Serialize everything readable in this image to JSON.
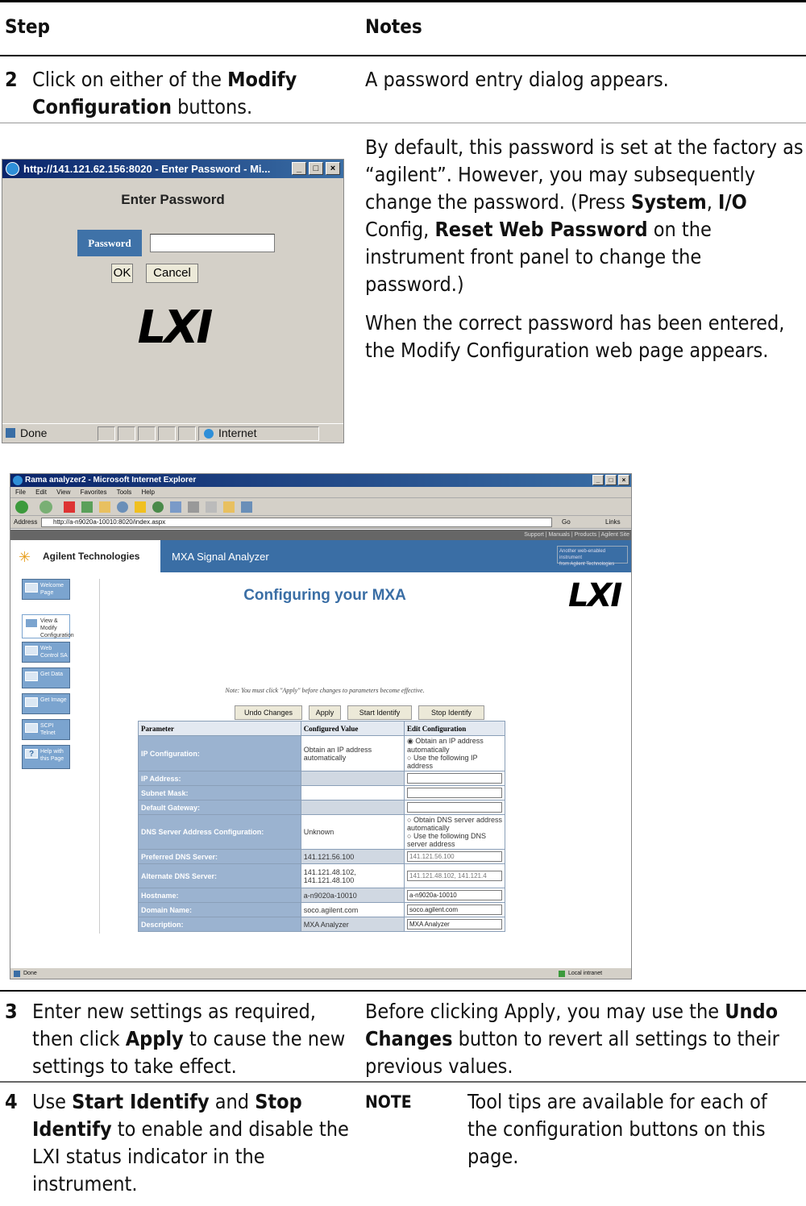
{
  "header": {
    "step": "Step",
    "notes": "Notes"
  },
  "step2": {
    "num": "2",
    "text1": "Click on either of the ",
    "bold1": "Modify",
    "bold2": "Configuration",
    "text2": " buttons.",
    "note": "A password entry dialog appears."
  },
  "notes_block": {
    "p1_a": "By default, this password is set at the factory as",
    "p1_b": "“agilent”. However, you may subsequently",
    "p1_c1": "change the password. (Press ",
    "p1_c_b1": "System",
    "p1_c2": ", ",
    "p1_c_b2": "I/O",
    "p1_d1": "Config, ",
    "p1_d_b": "Reset Web Password",
    "p1_d2": " on the",
    "p1_e": "instrument front panel to change the password.)",
    "p2_a": "When the correct password has been entered,",
    "p2_b": "the Modify Configuration web page appears."
  },
  "password_dialog": {
    "title": "http://141.121.62.156:8020 - Enter Password - Mi...",
    "heading": "Enter Password",
    "label": "Password",
    "ok": "OK",
    "cancel": "Cancel",
    "logo": "LXI",
    "status": "Done",
    "zone": "Internet"
  },
  "browser": {
    "title": "Rama analyzer2 - Microsoft Internet Explorer",
    "menu": [
      "File",
      "Edit",
      "View",
      "Favorites",
      "Tools",
      "Help"
    ],
    "address_label": "Address",
    "address": "http://a-n9020a-10010:8020/index.aspx",
    "go": "Go",
    "links": "Links",
    "top_links": "Support | Manuals | Products | Agilent Site",
    "brand": "Agilent Technologies",
    "product": "MXA Signal Analyzer",
    "banner_note_1": "Another web-enabled instrument",
    "banner_note_2": "from Agilent Technologies",
    "page_title": "Configuring your MXA",
    "logo": "LXI",
    "note": "Note: You must click \"Apply\" before changes to parameters become effective.",
    "nav": [
      {
        "label": "Welcome Page"
      },
      {
        "label": "View & Modify Configuration"
      },
      {
        "label": "Web Control SA"
      },
      {
        "label": "Get Data"
      },
      {
        "label": "Get Image"
      },
      {
        "label": "SCPI Telnet"
      },
      {
        "label": "Help with this Page"
      }
    ],
    "buttons": {
      "undo": "Undo Changes",
      "apply": "Apply",
      "start": "Start Identify",
      "stop": "Stop Identify"
    },
    "table_header": {
      "param": "Parameter",
      "configured": "Configured Value",
      "edit": "Edit Configuration"
    },
    "rows": [
      {
        "param": "IP Configuration:",
        "value": "Obtain an IP address automatically",
        "edit1": "Obtain an IP address automatically",
        "edit2": "Use the following IP address"
      },
      {
        "param": "IP Address:",
        "value": "",
        "edit": ""
      },
      {
        "param": "Subnet Mask:",
        "value": "",
        "edit": ""
      },
      {
        "param": "Default Gateway:",
        "value": "",
        "edit": ""
      },
      {
        "param": "DNS Server Address Configuration:",
        "value": "Unknown",
        "edit1": "Obtain DNS server address automatically",
        "edit2": "Use the following DNS server address"
      },
      {
        "param": "Preferred DNS Server:",
        "value": "141.121.56.100",
        "edit": "141.121.56.100"
      },
      {
        "param": "Alternate DNS Server:",
        "value": "141.121.48.102, 141.121.48.100",
        "edit": "141.121.48.102, 141.121.4"
      },
      {
        "param": "Hostname:",
        "value": "a-n9020a-10010",
        "edit": "a-n9020a-10010"
      },
      {
        "param": "Domain Name:",
        "value": "soco.agilent.com",
        "edit": "soco.agilent.com"
      },
      {
        "param": "Description:",
        "value": "MXA Analyzer",
        "edit": "MXA Analyzer"
      }
    ],
    "status": "Done",
    "zone": "Local intranet"
  },
  "step3": {
    "num": "3",
    "l1": "Enter new settings as required,",
    "l2a": "then click ",
    "l2b": "Apply",
    "l2c": " to cause the new",
    "l3": "settings to take effect.",
    "n1a": "Before clicking Apply, you may use the ",
    "n1b": "Undo",
    "n2a": "Changes",
    "n2b": " button to revert all settings to their",
    "n3": "previous values."
  },
  "step4": {
    "num": "4",
    "l1a": "Use ",
    "l1b": "Start Identify",
    "l1c": " and ",
    "l1d": "Stop",
    "l2a": "Identify",
    "l2b": " to enable and disable the",
    "l3": "LXI status indicator in the",
    "l4": "instrument.",
    "note_label": "NOTE",
    "note1": "Tool tips are available for each of",
    "note2": "the configuration buttons on this",
    "note3": "page."
  }
}
